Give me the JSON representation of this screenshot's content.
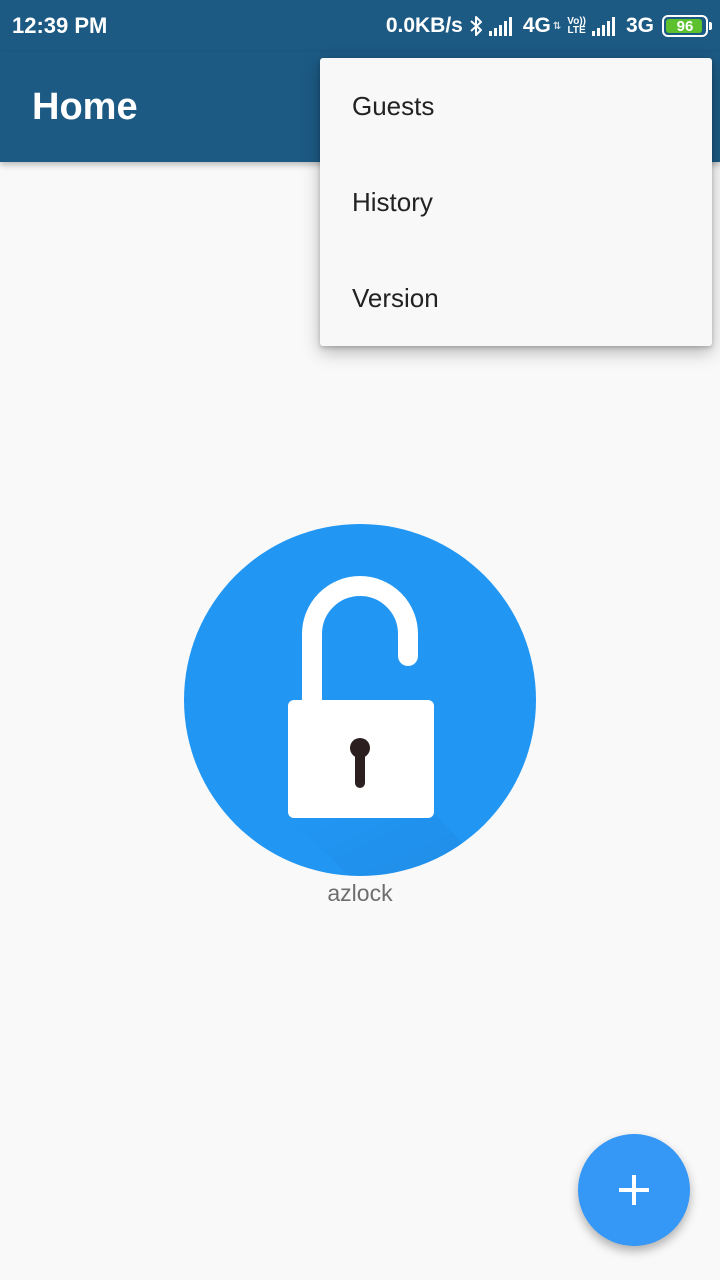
{
  "status_bar": {
    "time": "12:39 PM",
    "net_speed": "0.0KB/s",
    "network_1": "4G",
    "volte_top": "Vo))",
    "volte_bottom": "LTE",
    "network_2": "3G",
    "battery": "96",
    "icons": [
      "bluetooth-icon",
      "signal-icon",
      "signal-icon",
      "battery-icon"
    ]
  },
  "app_bar": {
    "title": "Home"
  },
  "menu": {
    "items": [
      {
        "label": "Guests"
      },
      {
        "label": "History"
      },
      {
        "label": "Version"
      }
    ]
  },
  "lock": {
    "name": "azlock",
    "icon": "unlocked-padlock-icon",
    "state": "unlocked"
  },
  "fab": {
    "icon": "plus-icon"
  },
  "colors": {
    "app_bar": "#1c5a84",
    "lock_circle": "#2196f3",
    "fab": "#3597f6",
    "battery": "#5cc12d"
  }
}
